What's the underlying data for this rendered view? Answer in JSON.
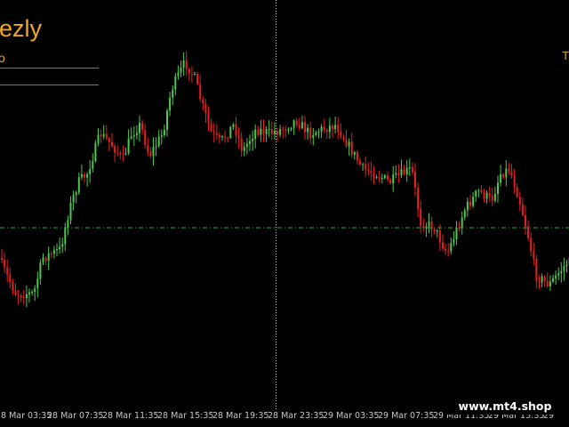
{
  "header": {
    "title": "ezly",
    "subtitle": "o",
    "corner_letter": "T"
  },
  "colors": {
    "background": "#000000",
    "bull_candle": "#4cc94c",
    "bear_candle": "#e81e1e",
    "crosshair": "#cccccc",
    "price_line": "#3aa83a",
    "title_text": "#f5a623"
  },
  "time_axis": {
    "labels": [
      "8 Mar 03:35",
      "28 Mar 07:35",
      "28 Mar 11:35",
      "28 Mar 15:35",
      "28 Mar 19:35",
      "28 Mar 23:35",
      "29 Mar 03:35",
      "29 Mar 07:35",
      "29 Mar 11:35",
      "29 Mar 15:35",
      "29"
    ]
  },
  "watermark": "www.mt4.shop"
}
